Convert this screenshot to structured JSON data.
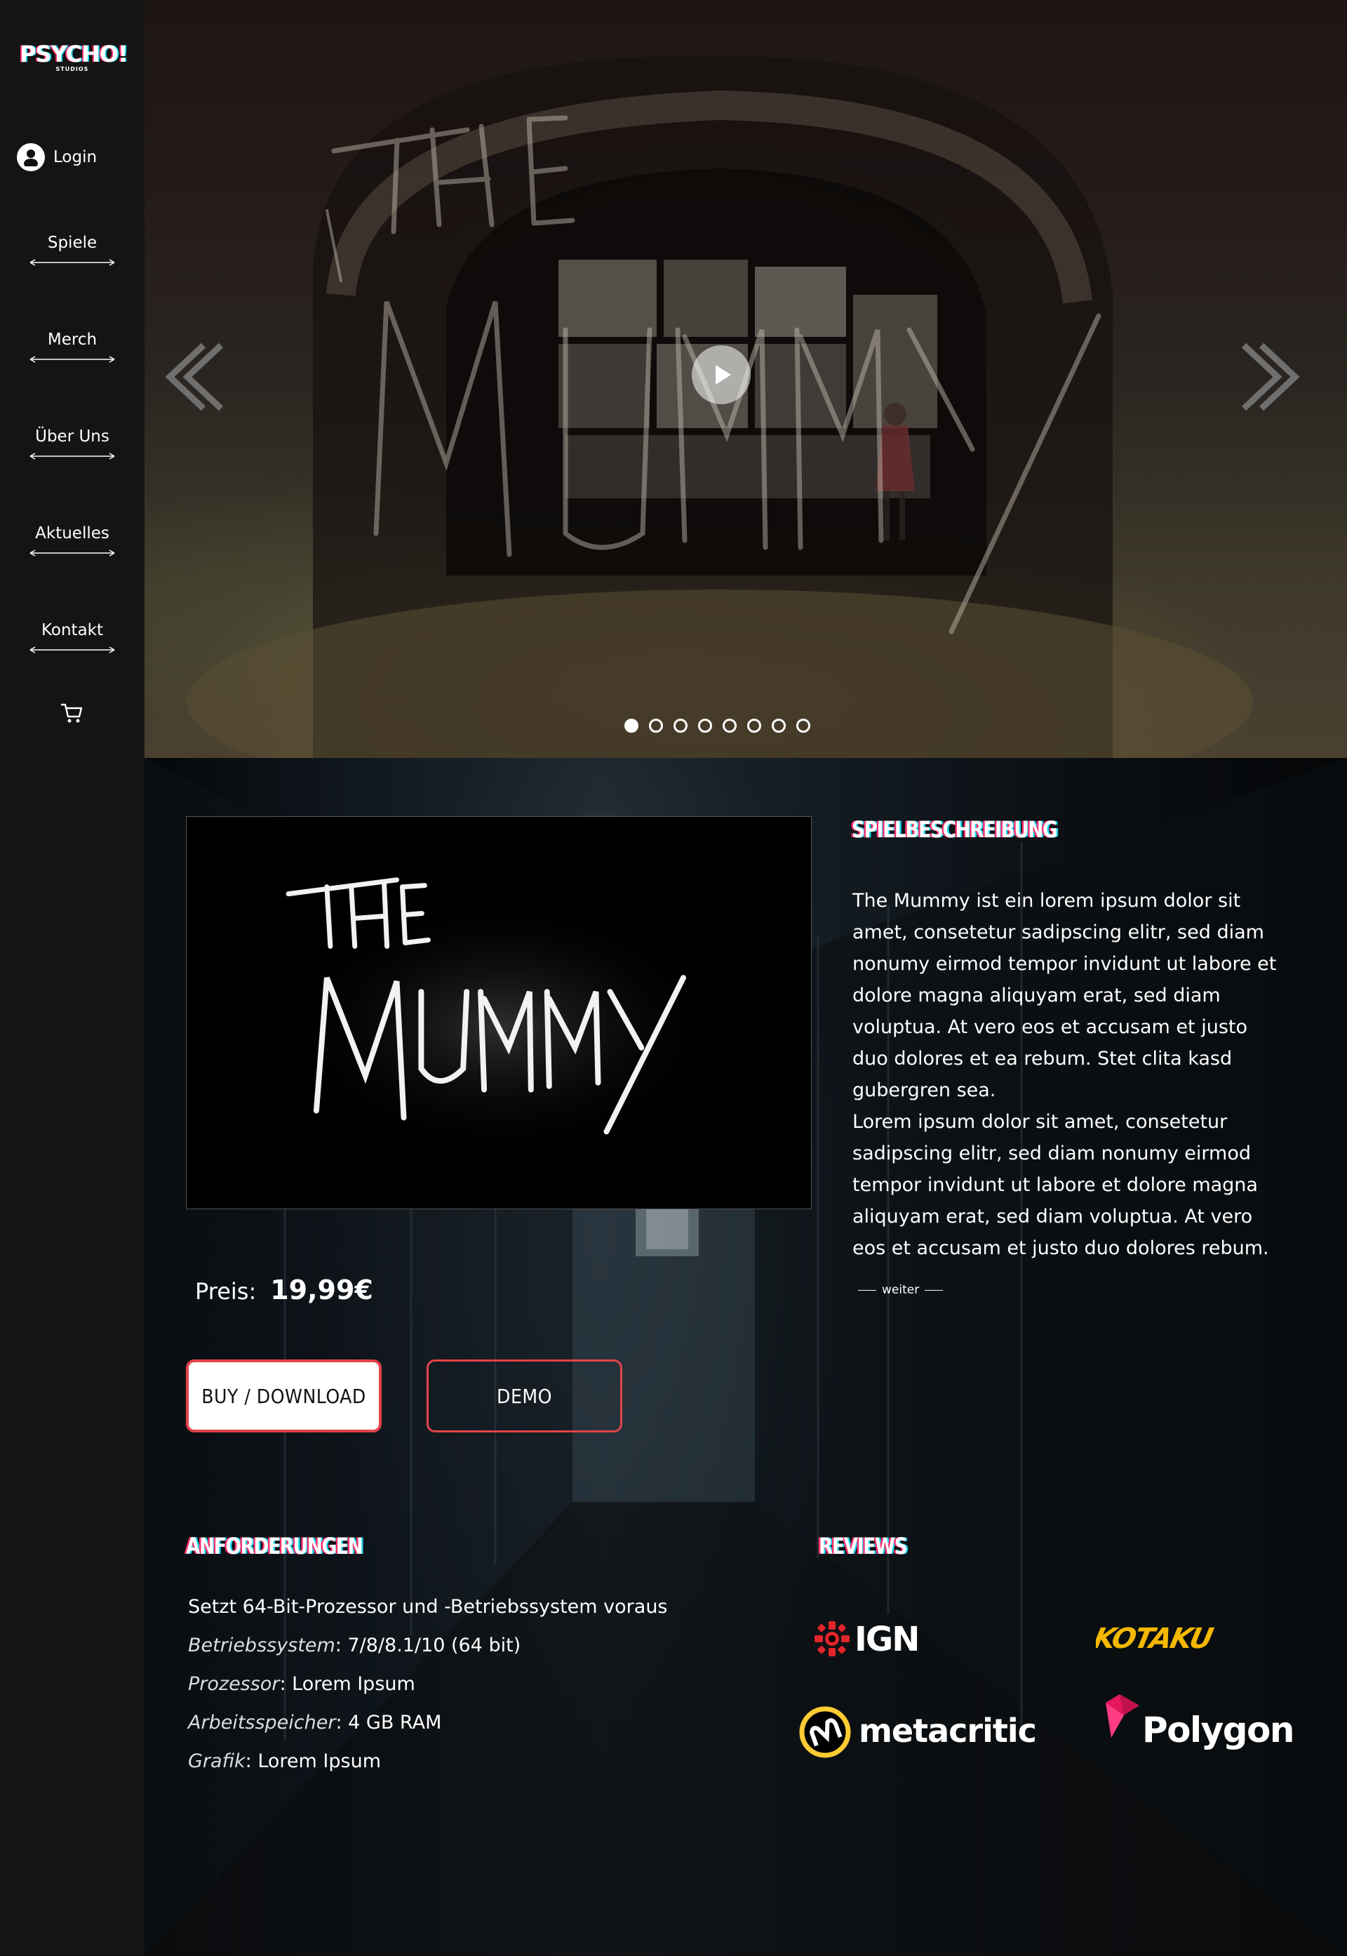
{
  "brand": {
    "name": "PSYCHO!",
    "sub": "STUDIOS"
  },
  "nav": {
    "login": "Login",
    "items": [
      {
        "label": "Spiele"
      },
      {
        "label": "Merch"
      },
      {
        "label": "Über Uns"
      },
      {
        "label": "Aktuelles"
      },
      {
        "label": "Kontakt"
      }
    ],
    "cart_icon": "cart-icon"
  },
  "hero": {
    "slide_count": 8,
    "active_slide": 1,
    "title_art": "THE MUMMY"
  },
  "game": {
    "cover_title_line1": "THE",
    "cover_title_line2": "MUMMY",
    "price_label": "Preis:",
    "price_value": "19,99€",
    "buy_label": "BUY / DOWNLOAD",
    "demo_label": "DEMO"
  },
  "description": {
    "heading": "SPIELBESCHREIBUNG",
    "paragraph1": "The Mummy ist ein lorem ipsum dolor sit amet, consetetur sadipscing elitr, sed diam nonumy eirmod tempor invidunt ut labore et dolore magna aliquyam erat, sed diam voluptua. At vero eos et accusam et justo duo dolores et ea rebum. Stet clita kasd gubergren sea.",
    "paragraph2": "Lorem ipsum dolor sit amet, consetetur sadipscing elitr, sed diam nonumy eirmod tempor invidunt ut labore et dolore magna aliquyam erat, sed diam voluptua. At vero eos et accusam et justo duo dolores rebum.",
    "more": "weiter"
  },
  "requirements": {
    "heading": "ANFORDERUNGEN",
    "intro": "Setzt 64-Bit-Prozessor und -Betriebssystem voraus",
    "items": [
      {
        "key": "Betriebssystem",
        "value": ": 7/8/8.1/10 (64 bit)"
      },
      {
        "key": "Prozessor",
        "value": ": Lorem Ipsum"
      },
      {
        "key": "Arbeitsspeicher",
        "value": ": 4 GB RAM"
      },
      {
        "key": "Grafik",
        "value": ": Lorem Ipsum"
      }
    ]
  },
  "reviews": {
    "heading": "REVIEWS",
    "logos": [
      "IGN",
      "KOTAKU",
      "metacritic",
      "Polygon"
    ]
  },
  "colors": {
    "sidebar": "#141414",
    "accent_red": "#e2434b",
    "glitch_pink": "#ff2d6b",
    "glitch_cyan": "#23d8f0",
    "kotaku_yellow": "#f5b800",
    "metacritic_yellow": "#ffcc33",
    "polygon_pink": "#e5185c"
  }
}
